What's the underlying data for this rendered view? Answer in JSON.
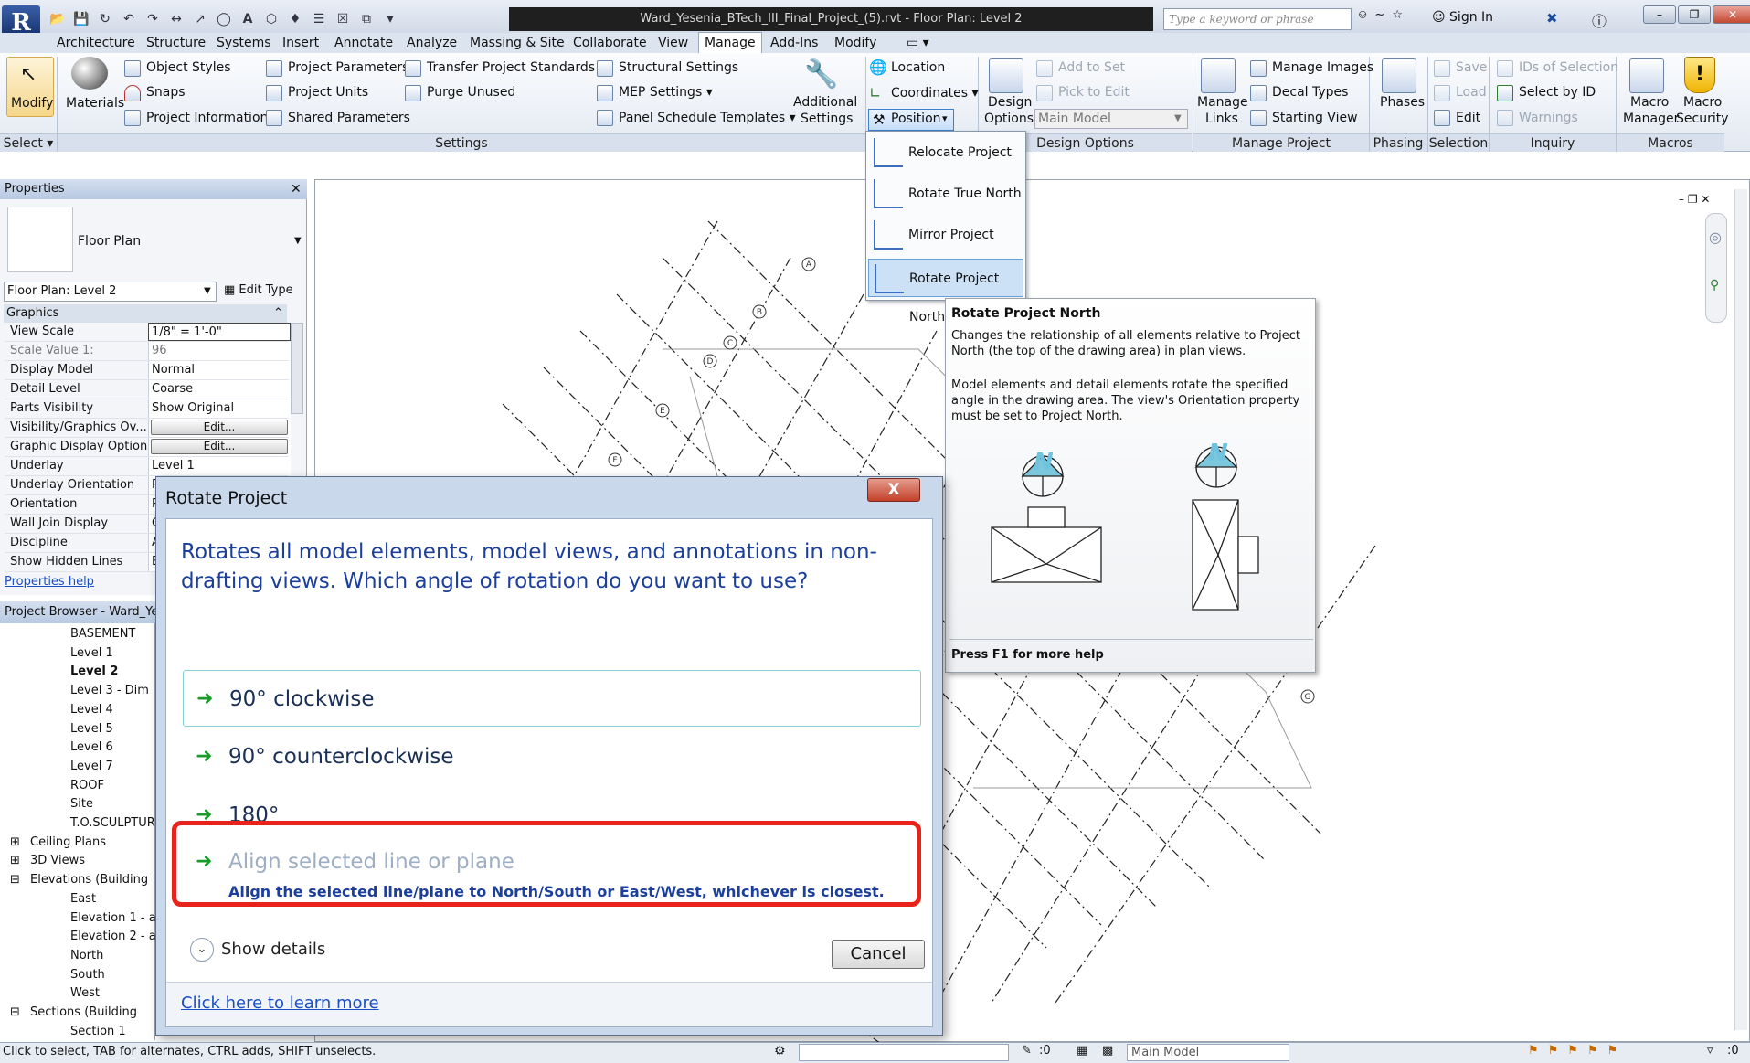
{
  "app": {
    "logo_letter": "R",
    "window_title": "Ward_Yesenia_BTech_III_Final_Project_(5).rvt - Floor Plan: Level 2",
    "search_placeholder": "Type a keyword or phrase",
    "sign_in": "Sign In"
  },
  "ribbon_tabs": [
    "Architecture",
    "Structure",
    "Systems",
    "Insert",
    "Annotate",
    "Analyze",
    "Massing & Site",
    "Collaborate",
    "View",
    "Manage",
    "Add-Ins",
    "Modify"
  ],
  "active_tab": "Manage",
  "ribbon": {
    "select": {
      "modify_label": "Modify",
      "group_label": "Select"
    },
    "materials_label": "Materials",
    "settings": {
      "items": [
        "Object Styles",
        "Snaps",
        "Project Information",
        "Project Parameters",
        "Project Units",
        "Shared Parameters",
        "Transfer Project Standards",
        "Purge Unused",
        "Structural Settings",
        "MEP Settings",
        "Panel Schedule Templates"
      ],
      "additional_line1": "Additional",
      "additional_line2": "Settings",
      "group_label": "Settings"
    },
    "location": {
      "location": "Location",
      "coordinates": "Coordinates",
      "position": "Position"
    },
    "design_options": {
      "design_line1": "Design",
      "design_line2": "Options",
      "add_to_set": "Add to Set",
      "pick_to_edit": "Pick to Edit",
      "main_model": "Main Model",
      "group_label": "Design Options"
    },
    "manage_project": {
      "manage_line1": "Manage",
      "manage_line2": "Links",
      "manage_images": "Manage Images",
      "decal_types": "Decal Types",
      "starting_view": "Starting View",
      "group_label": "Manage Project"
    },
    "phasing": {
      "phases": "Phases",
      "group_label": "Phasing"
    },
    "selection": {
      "save": "Save",
      "load": "Load",
      "edit": "Edit",
      "group_label": "Selection"
    },
    "inquiry": {
      "ids_of_selection": "IDs of Selection",
      "select_by_id": "Select by ID",
      "warnings": "Warnings",
      "group_label": "Inquiry"
    },
    "macros": {
      "mm_line1": "Macro",
      "mm_line2": "Manager",
      "ms_line1": "Macro",
      "ms_line2": "Security",
      "group_label": "Macros"
    }
  },
  "position_menu": [
    "Relocate Project",
    "Rotate True North",
    "Mirror Project",
    "Rotate Project North"
  ],
  "tooltip": {
    "title": "Rotate Project North",
    "body1": "Changes the relationship of all elements relative to Project North (the top of the drawing area) in plan views.",
    "body2": "Model elements and detail elements rotate the specified angle in the drawing area. The view's Orientation property must be set to Project North.",
    "n_label": "N",
    "footer": "Press F1 for more help"
  },
  "properties": {
    "title": "Properties",
    "type_name": "Floor Plan",
    "instance_selector": "Floor Plan: Level 2",
    "edit_type": "Edit Type",
    "section": "Graphics",
    "rows": [
      {
        "k": "View Scale",
        "v": "1/8\" = 1'-0\""
      },
      {
        "k": "Scale Value    1:",
        "v": "96"
      },
      {
        "k": "Display Model",
        "v": "Normal"
      },
      {
        "k": "Detail Level",
        "v": "Coarse"
      },
      {
        "k": "Parts Visibility",
        "v": "Show Original"
      },
      {
        "k": "Visibility/Graphics Ov...",
        "v": "Edit..."
      },
      {
        "k": "Graphic Display Options",
        "v": "Edit..."
      },
      {
        "k": "Underlay",
        "v": "Level 1"
      },
      {
        "k": "Underlay Orientation",
        "v": "P"
      },
      {
        "k": "Orientation",
        "v": "P"
      },
      {
        "k": "Wall Join Display",
        "v": "C"
      },
      {
        "k": "Discipline",
        "v": "A"
      },
      {
        "k": "Show Hidden Lines",
        "v": "B"
      }
    ],
    "help_link": "Properties help"
  },
  "browser": {
    "title": "Project Browser - Ward_Yese",
    "items": [
      {
        "t": "BASEMENT",
        "l": 2
      },
      {
        "t": "Level 1",
        "l": 2
      },
      {
        "t": "Level 2",
        "l": 2,
        "b": true
      },
      {
        "t": "Level 3 - Dim",
        "l": 2
      },
      {
        "t": "Level 4",
        "l": 2
      },
      {
        "t": "Level 5",
        "l": 2
      },
      {
        "t": "Level 6",
        "l": 2
      },
      {
        "t": "Level 7",
        "l": 2
      },
      {
        "t": "ROOF",
        "l": 2
      },
      {
        "t": "Site",
        "l": 2
      },
      {
        "t": "T.O.SCULPTURE",
        "l": 2
      },
      {
        "t": "Ceiling Plans",
        "l": 1
      },
      {
        "t": "3D Views",
        "l": 1
      },
      {
        "t": "Elevations (Building",
        "l": 1
      },
      {
        "t": "East",
        "l": 2
      },
      {
        "t": "Elevation 1 - a",
        "l": 2
      },
      {
        "t": "Elevation 2 - a",
        "l": 2
      },
      {
        "t": "North",
        "l": 2
      },
      {
        "t": "South",
        "l": 2
      },
      {
        "t": "West",
        "l": 2
      },
      {
        "t": "Sections (Building",
        "l": 1
      },
      {
        "t": "Section 1",
        "l": 2
      }
    ]
  },
  "grid_bubbles": [
    "A",
    "B",
    "C",
    "D",
    "E",
    "F",
    "G"
  ],
  "dialog": {
    "title": "Rotate Project",
    "close": "X",
    "instruction": "Rotates all model elements, model views, and annotations in non-drafting views.  Which angle of rotation do you want to use?",
    "options": [
      "90° clockwise",
      "90° counterclockwise",
      "180°"
    ],
    "align_title": "Align selected line or plane",
    "align_desc": "Align the selected line/plane to North/South or East/West, whichever is closest.",
    "show_details": "Show details",
    "cancel": "Cancel",
    "learn_more": "Click here to learn more"
  },
  "status": {
    "text": "Click to select, TAB for alternates, CTRL adds, SHIFT unselects.",
    "zero": ":0",
    "model": "Main Model"
  },
  "colors": {
    "highlight": "#e8231c",
    "link": "#1a4ec4",
    "instruction": "#1b3f9a"
  }
}
